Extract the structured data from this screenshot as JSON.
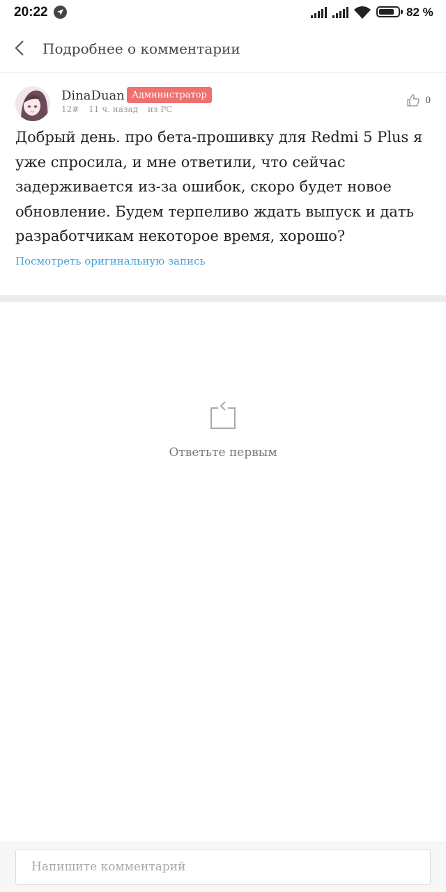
{
  "status_bar": {
    "time": "20:22",
    "battery_percent": "82 %",
    "battery_level": 0.82,
    "icons": [
      "navigation-icon",
      "signal-icon",
      "signal-icon",
      "wifi-icon",
      "battery-icon"
    ]
  },
  "header": {
    "title": "Подробнее о комментарии",
    "back_icon": "chevron-left-icon"
  },
  "comment": {
    "username": "DinaDuan",
    "badge": "Администратор",
    "floor": "12#",
    "time_ago": "11 ч. назад",
    "source": "из PC",
    "likes": "0",
    "text": "Добрый день. про бета-прошивку для Redmi 5 Plus я уже спросила, и мне ответили, что сейчас задерживается из-за ошибок, скоро будет новое обновление. Будем терпеливо ждать выпуск и дать разработчикам некоторое время, хорошо?",
    "original_link": "Посмотреть оригинальную запись"
  },
  "empty_state": {
    "icon": "share-box-icon",
    "text": "Ответьте первым"
  },
  "input": {
    "placeholder": "Напишите комментарий"
  },
  "colors": {
    "badge": "#f07070",
    "link": "#4aa3d8"
  }
}
